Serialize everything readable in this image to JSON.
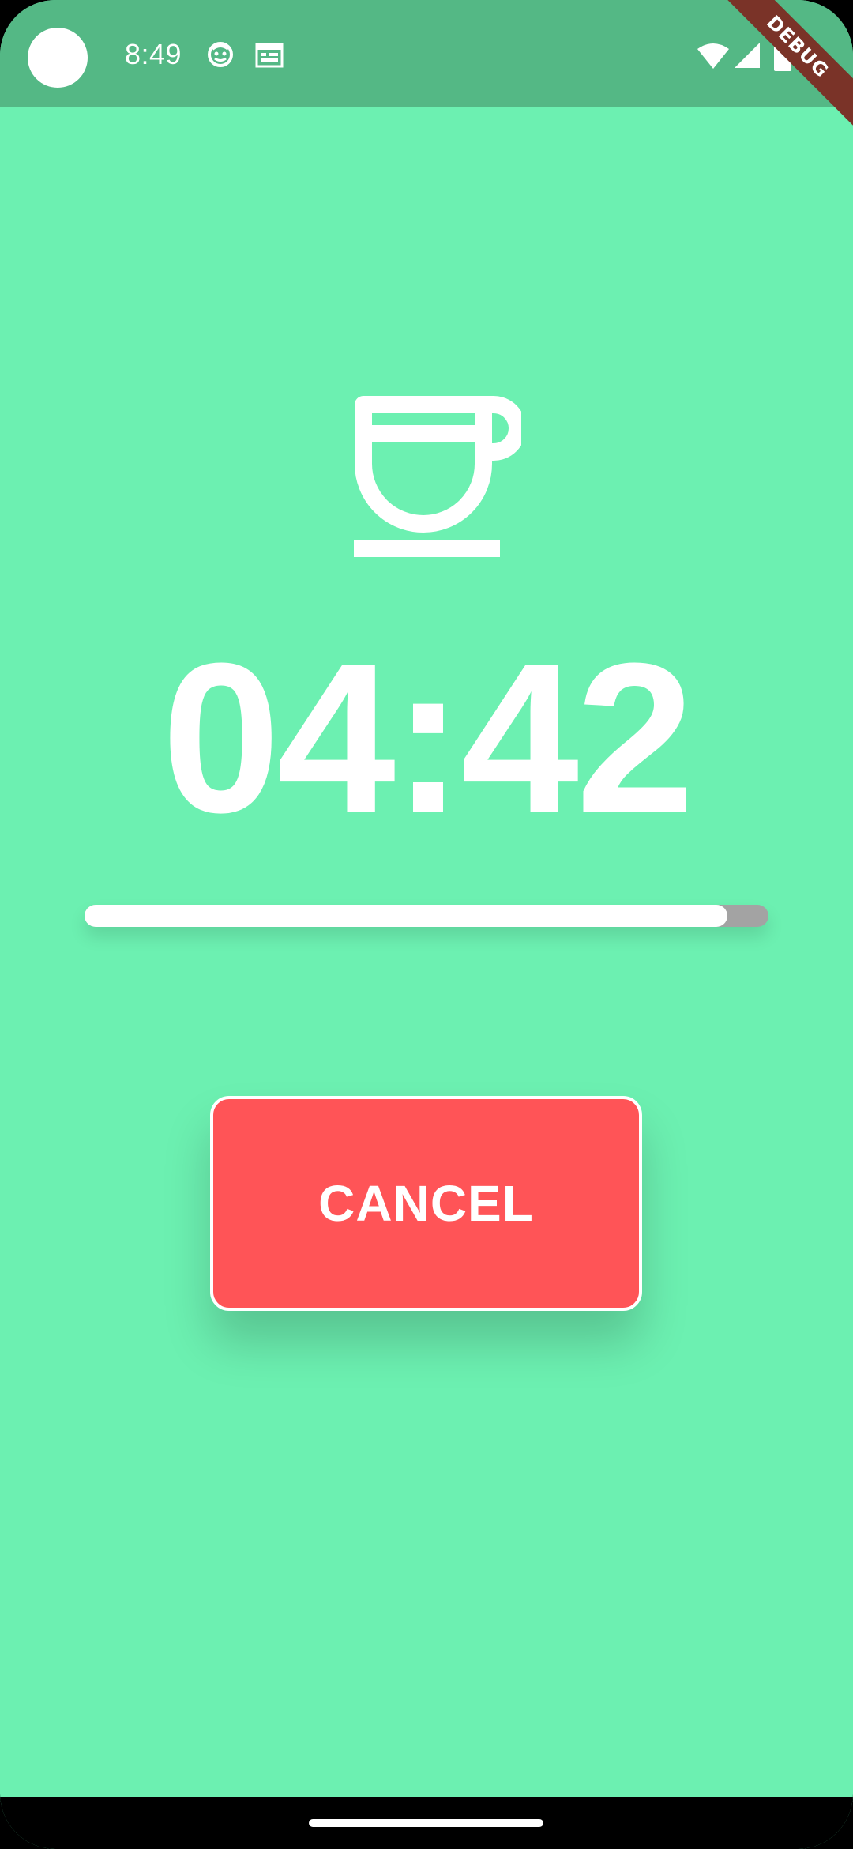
{
  "status_bar": {
    "time": "8:49",
    "debug_label": "DEBUG",
    "icons": [
      "camera-dot",
      "face-icon",
      "calendar-icon",
      "wifi-icon",
      "signal-icon",
      "battery-icon"
    ],
    "background_color": "#54B885"
  },
  "timer": {
    "display": "04:42",
    "progress": 0.94,
    "icon": "coffee-cup-icon"
  },
  "actions": {
    "cancel_label": "CANCEL"
  },
  "colors": {
    "background": "#6CF0B1",
    "cancel_button": "#FF5457",
    "progress_track": "#A3A3A3",
    "progress_fill": "#FFFFFF",
    "debug_ribbon": "#7A3328"
  }
}
